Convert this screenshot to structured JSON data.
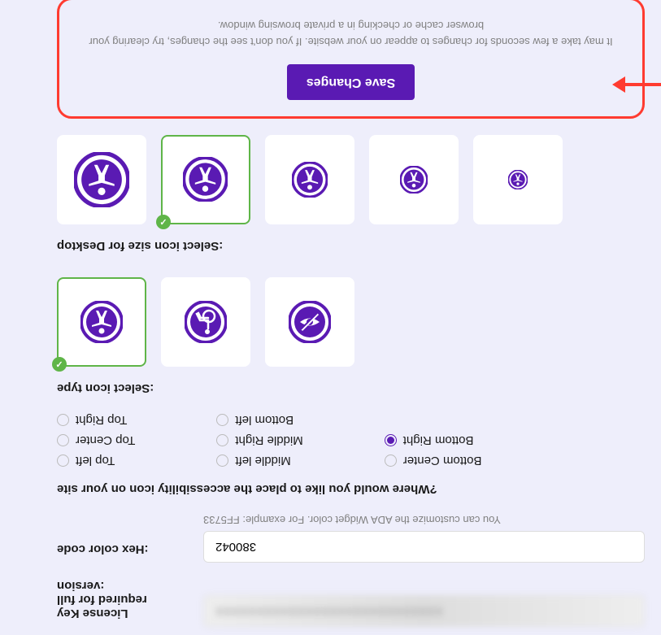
{
  "license": {
    "label": "License Key required for full version:",
    "value": "XXXXXXXXXXXXXXXXXXXXXXXXXXXX"
  },
  "hexcolor": {
    "label": "Hex color code:",
    "value": "380042",
    "help": "You can customize the ADA Widget color. For example: FF5733"
  },
  "placement": {
    "label": "Where would you like to place the accessibility icon on your site?",
    "col1": [
      "Top left",
      "Top Center",
      "Top Right"
    ],
    "col2": [
      "Middle left",
      "Middle Right",
      "Bottom left"
    ],
    "col3": [
      "Bottom Center",
      "Bottom Right"
    ],
    "selected": "Bottom Right"
  },
  "icontype": {
    "label": "Select icon type:"
  },
  "iconsize": {
    "label": "Select icon size for Desktop:"
  },
  "save": {
    "button": "Save Changes",
    "note": "It may take a few seconds for changes to appear on your website. If you don't see the changes, try clearing your browser cache or checking in a private browsing window."
  },
  "colors": {
    "primary": "#5a1ab3",
    "success": "#5fb548",
    "alert": "#ff3b30"
  }
}
